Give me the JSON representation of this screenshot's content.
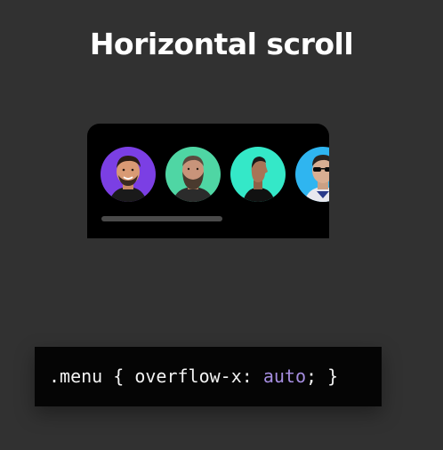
{
  "title": "Horizontal scroll",
  "menu": {
    "avatars": [
      {
        "name": "avatar-1",
        "bg": "#7b3fe4"
      },
      {
        "name": "avatar-2",
        "bg": "#4fd6a4"
      },
      {
        "name": "avatar-3",
        "bg": "#34e8c8"
      },
      {
        "name": "avatar-4",
        "bg": "#2fb5f0"
      }
    ],
    "scroll_progress": 0.0
  },
  "code": {
    "selector": ".menu",
    "open_brace": " { ",
    "property": "overflow-x: ",
    "value": "auto",
    "close": "; }"
  },
  "colors": {
    "background": "#313131",
    "card": "#000000",
    "code_value": "#a58de0"
  }
}
